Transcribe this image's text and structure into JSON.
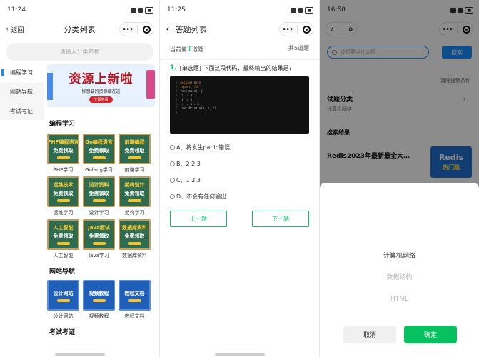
{
  "panel1": {
    "time": "11:24",
    "back_label": "返回",
    "title": "分类列表",
    "search_placeholder": "请输入分类名称",
    "sidebar": [
      {
        "label": "编程学习"
      },
      {
        "label": "网站导航"
      },
      {
        "label": "考试考证"
      }
    ],
    "banner": {
      "main": "资源上新啦",
      "sub": "你想要的资源都在这",
      "btn": "立即查看"
    },
    "section1": "编程学习",
    "grid1": [
      {
        "t1": "PHP编程语言",
        "t2": "免费领取",
        "label": "PHP学习"
      },
      {
        "t1": "Go编程语言",
        "t2": "免费领取",
        "label": "Golang学习"
      },
      {
        "t1": "前端编程",
        "t2": "免费领取",
        "label": "前端学习"
      },
      {
        "t1": "运维技术",
        "t2": "免费领取",
        "label": "运维学习"
      },
      {
        "t1": "设计资料",
        "t2": "免费领取",
        "label": "设计学习"
      },
      {
        "t1": "架构设计",
        "t2": "免费领取",
        "label": "架构学习"
      },
      {
        "t1": "人工智能",
        "t2": "免费领取",
        "label": "人工智能"
      },
      {
        "t1": "Java面试",
        "t2": "免费领取",
        "label": "Java学习"
      },
      {
        "t1": "数据库资料",
        "t2": "免费领取",
        "label": "数据库资料"
      }
    ],
    "section2": "网站导航",
    "grid2": [
      {
        "t1": "设计网站",
        "label": "设计网站"
      },
      {
        "t1": "视频教程",
        "label": "视频教程"
      },
      {
        "t1": "教程文档",
        "label": "教程文档"
      }
    ],
    "section3": "考试考证"
  },
  "panel2": {
    "time": "11:25",
    "title": "答题列表",
    "current_prefix": "当前第",
    "current_num": "1",
    "current_suffix": "道题",
    "total": "共5道题",
    "question": "[单选题] 下面这段代码，最终输出的结果是？",
    "code_lines": [
      "package main",
      "import \"fmt\"",
      "func main() {",
      "  a := 1",
      "  b := 2",
      "  c := a + b",
      "  fmt.Println(a, b, c)",
      "}"
    ],
    "options": [
      "A、将发生panic错误",
      "B、2 2 3",
      "C、1 2 3",
      "D、不会有任何输出"
    ],
    "prev_label": "上一题",
    "next_label": "下一题"
  },
  "panel3": {
    "time": "16:50",
    "search_placeholder": "你想要点什么啊",
    "search_btn": "搜索",
    "clear_label": "清除搜索条件",
    "category_label": "试题分类",
    "category_value": "计算机网络",
    "results_title": "搜索结果",
    "result_text": "Redis2023年最新最全大…",
    "result_img_a": "Redis",
    "result_img_b": "热门题",
    "picker_options": [
      "计算机网络",
      "数据结构",
      "HTML"
    ],
    "cancel_label": "取消",
    "confirm_label": "确定"
  },
  "colors": {
    "green": "#07c160",
    "blue": "#1a8cff"
  }
}
